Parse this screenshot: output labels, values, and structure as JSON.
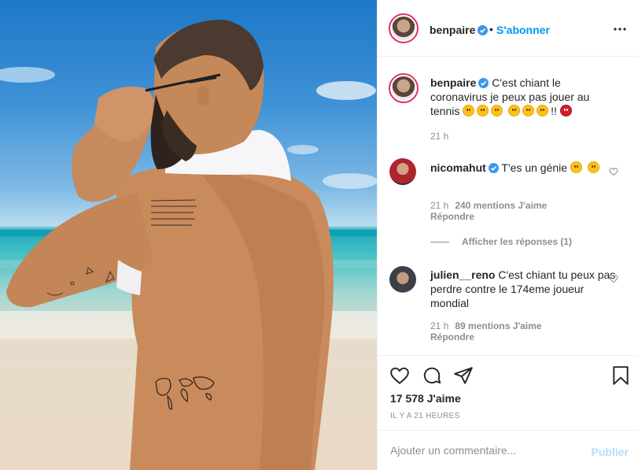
{
  "post": {
    "author": "benpaire",
    "follow_label": "S'abonner",
    "separator": "•",
    "caption_text": "C'est chiant le coronavirus je peux pas jouer au tennis",
    "caption_suffix": "!!",
    "caption_time": "21 h"
  },
  "comments": [
    {
      "user": "nicomahut",
      "verified": true,
      "text": "T'es un génie",
      "time": "21 h",
      "likes": "240 mentions J'aime",
      "reply": "Répondre"
    },
    {
      "user": "julien__reno",
      "verified": false,
      "text": "C'est chiant tu peux pas perdre contre le 174eme joueur mondial",
      "time": "21 h",
      "likes": "89 mentions J'aime",
      "reply": "Répondre"
    }
  ],
  "show_replies": "Afficher les réponses (1)",
  "footer": {
    "likes": "17 578 J'aime",
    "timestamp": "IL Y A 21 HEURES",
    "comment_placeholder": "Ajouter un commentaire...",
    "publish": "Publier"
  },
  "colors": {
    "accent": "#0095f6",
    "verified": "#3897f0",
    "muted": "#8e8e8e",
    "publish_disabled": "#b2dffc",
    "ring": "#e1306c"
  },
  "icons": [
    "more-icon",
    "heart-icon",
    "comment-icon",
    "share-icon",
    "bookmark-icon",
    "verified-badge-icon",
    "small-heart-icon"
  ]
}
